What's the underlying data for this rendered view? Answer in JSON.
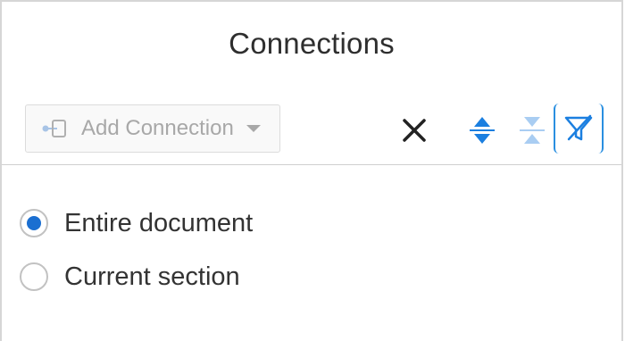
{
  "panel": {
    "title": "Connections"
  },
  "toolbar": {
    "add_connection_label": "Add Connection",
    "icons": {
      "add": "connection-icon",
      "close": "close-icon",
      "expand": "expand-all-icon",
      "collapse": "collapse-all-icon",
      "filter": "filter-off-icon"
    },
    "accent_color": "#2a8fe0"
  },
  "scope": {
    "options": [
      {
        "label": "Entire document",
        "selected": true
      },
      {
        "label": "Current section",
        "selected": false
      }
    ]
  }
}
